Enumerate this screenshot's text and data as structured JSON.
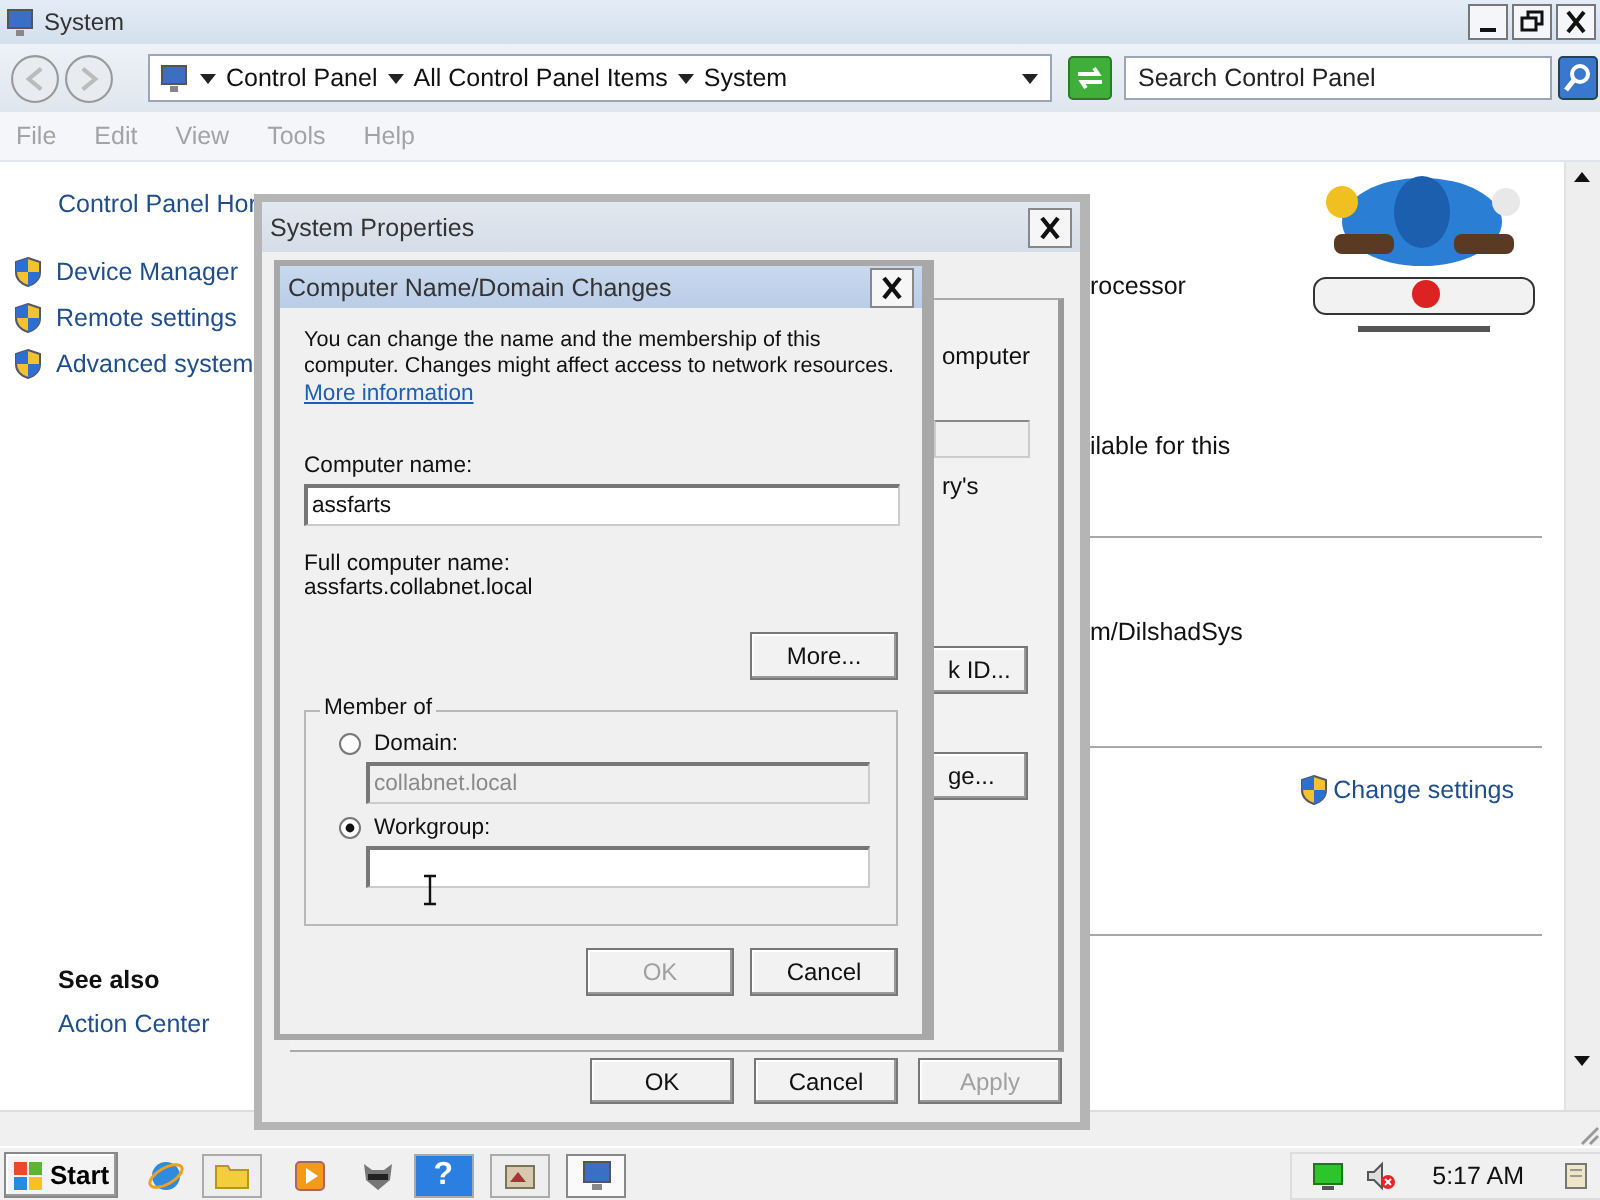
{
  "window": {
    "title": "System"
  },
  "address_bar": {
    "path": [
      "Control Panel",
      "All Control Panel Items",
      "System"
    ],
    "search": {
      "placeholder": "Search Control Panel"
    }
  },
  "menu": [
    "File",
    "Edit",
    "View",
    "Tools",
    "Help"
  ],
  "sidebar": {
    "home_link": "Control Panel Hor",
    "tasks": [
      "Device Manager",
      "Remote settings",
      "Advanced system"
    ],
    "see_also_title": "See also",
    "see_also": [
      "Action Center"
    ]
  },
  "content": {
    "fragments": [
      "rocessor",
      "ilable for this",
      "m/DilshadSys"
    ],
    "change_settings": "Change settings"
  },
  "system_properties": {
    "title": "System Properties",
    "fragments": [
      "omputer",
      "ry's"
    ],
    "partial_buttons": [
      "k ID...",
      "ge..."
    ],
    "buttons": [
      {
        "label": "OK",
        "disabled": false
      },
      {
        "label": "Cancel",
        "disabled": false
      },
      {
        "label": "Apply",
        "disabled": true
      }
    ]
  },
  "name_dialog": {
    "title": "Computer Name/Domain Changes",
    "intro": "You can change the name and the membership of this computer. Changes might affect access to network resources.",
    "more_info_link": "More information",
    "computer_name_label": "Computer name:",
    "computer_name": "assfarts",
    "full_name_label": "Full computer name:",
    "full_name": "assfarts.collabnet.local",
    "more_button": "More...",
    "member_of": {
      "title": "Member of",
      "options": [
        {
          "label": "Domain:",
          "selected": false,
          "value": "collabnet.local",
          "disabled": true
        },
        {
          "label": "Workgroup:",
          "selected": true,
          "disabled": false
        }
      ]
    },
    "buttons": [
      {
        "label": "OK",
        "disabled": true
      },
      {
        "label": "Cancel",
        "disabled": false
      }
    ]
  },
  "taskbar": {
    "start": "Start",
    "help_glyph": "?",
    "clock": "5:17 AM"
  }
}
